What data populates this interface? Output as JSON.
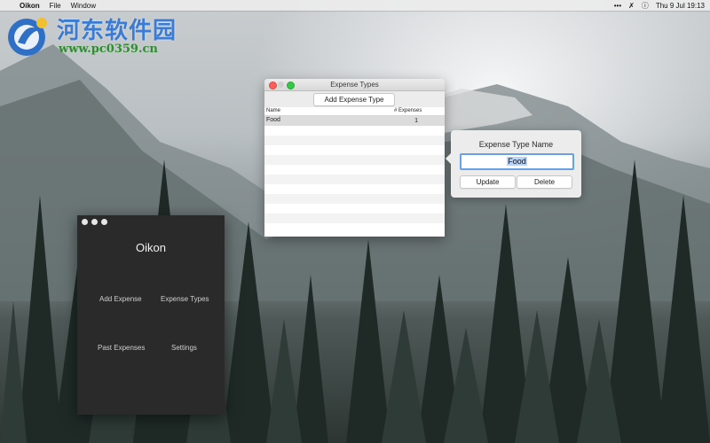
{
  "menubar": {
    "app_name": "Oikon",
    "menus": [
      "File",
      "Window"
    ],
    "clock": "Thu 9 Jul  19:13",
    "apple_glyph": "",
    "more_glyph": "•••"
  },
  "watermark": {
    "title": "河东软件园",
    "url": "www.pc0359.cn"
  },
  "main_window": {
    "title": "Oikon",
    "nav": {
      "add_expense": "Add Expense",
      "expense_types": "Expense Types",
      "past_expenses": "Past Expenses",
      "settings": "Settings"
    }
  },
  "types_window": {
    "title": "Expense Types",
    "add_button": "Add Expense Type",
    "columns": [
      "Name",
      "# Expenses"
    ],
    "rows": [
      {
        "name": "Food",
        "count": "1"
      }
    ]
  },
  "popover": {
    "title": "Expense Type Name",
    "field_value": "Food",
    "update_button": "Update",
    "delete_button": "Delete"
  },
  "colors": {
    "accent": "#6aa0e6",
    "close": "#fc5f57",
    "zoom": "#34c84a"
  }
}
